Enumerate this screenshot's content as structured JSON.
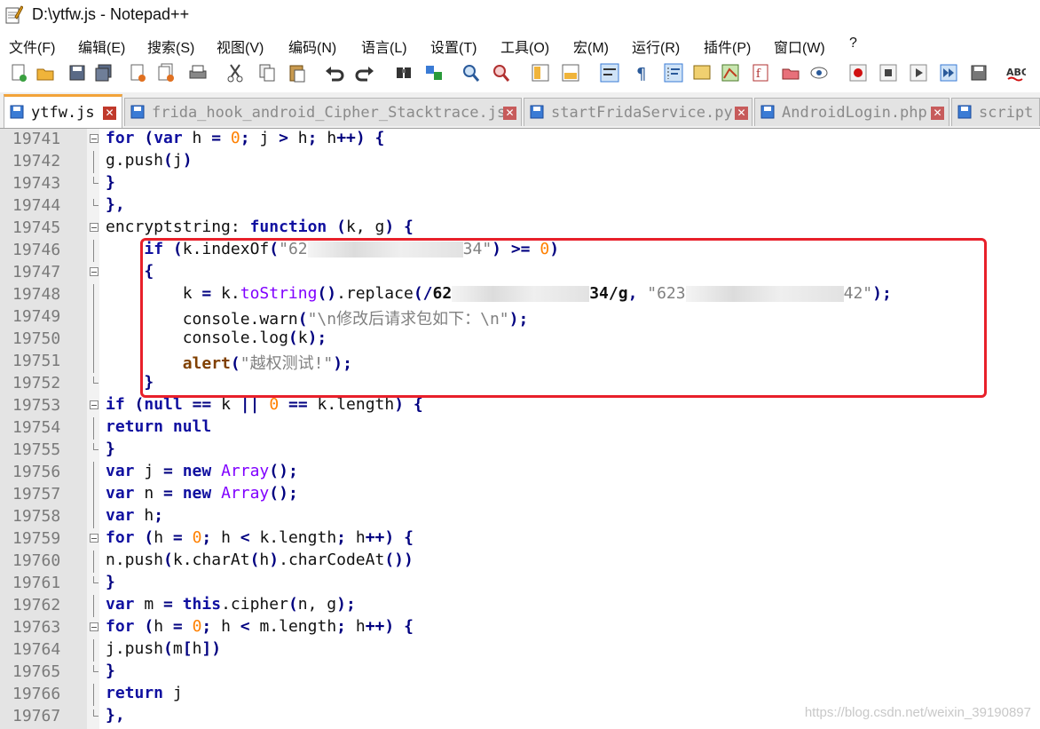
{
  "window": {
    "title": "D:\\ytfw.js - Notepad++"
  },
  "menu": [
    "文件(F)",
    "编辑(E)",
    "搜索(S)",
    "视图(V)",
    "编码(N)",
    "语言(L)",
    "设置(T)",
    "工具(O)",
    "宏(M)",
    "运行(R)",
    "插件(P)",
    "窗口(W)",
    "?"
  ],
  "tabs": [
    {
      "label": "ytfw.js",
      "active": true
    },
    {
      "label": "frida_hook_android_Cipher_Stacktrace.js",
      "active": false
    },
    {
      "label": "startFridaService.py",
      "active": false
    },
    {
      "label": "AndroidLogin.php",
      "active": false
    },
    {
      "label": "script",
      "active": false
    }
  ],
  "lines": [
    {
      "n": "19741",
      "fold": "box",
      "html": "<span class=\"kw\">for</span> <span class=\"op\">(</span><span class=\"kw\">var</span> h <span class=\"op\">=</span> <span class=\"num\">0</span><span class=\"op\">;</span> j <span class=\"op\">&gt;</span> h<span class=\"op\">;</span> h<span class=\"op\">++)</span> <span class=\"op\">{</span>"
    },
    {
      "n": "19742",
      "fold": "bar",
      "html": "g.push<span class=\"op\">(</span>j<span class=\"op\">)</span>"
    },
    {
      "n": "19743",
      "fold": "end",
      "html": "<span class=\"op\">}</span>"
    },
    {
      "n": "19744",
      "fold": "end",
      "html": "<span class=\"op\">},</span>"
    },
    {
      "n": "19745",
      "fold": "box",
      "html": "encryptstring: <span class=\"kw\">function</span> <span class=\"op\">(</span>k, g<span class=\"op\">)</span> <span class=\"op\">{</span>"
    },
    {
      "n": "19746",
      "fold": "bar",
      "html": "    <span class=\"kw\">if</span> <span class=\"op\">(</span>k.indexOf<span class=\"op\">(</span><span class=\"str\">\"62<span class=\"blur\" style=\"width:175px\"></span>34\"</span><span class=\"op\">)</span> <span class=\"op\">&gt;=</span> <span class=\"num\">0</span><span class=\"op\">)</span>"
    },
    {
      "n": "19747",
      "fold": "box",
      "html": "    <span class=\"op\">{</span>"
    },
    {
      "n": "19748",
      "fold": "bar",
      "html": "        k <span class=\"op\">=</span> k.<span class=\"fn\">toString</span><span class=\"op\">()</span>.replace<span class=\"op\">(/</span><b>62<span class=\"blur\" style=\"width:155px\"></span>34/g</b><span class=\"op\">,</span> <span class=\"str\">\"623<span class=\"blur\" style=\"width:178px\"></span>42\"</span><span class=\"op\">);</span>"
    },
    {
      "n": "19749",
      "fold": "bar",
      "html": "        console.warn<span class=\"op\">(</span><span class=\"str\">\"\\n修改后请求包如下：\\n\"</span><span class=\"op\">);</span>"
    },
    {
      "n": "19750",
      "fold": "bar",
      "html": "        console.log<span class=\"op\">(</span>k<span class=\"op\">);</span>"
    },
    {
      "n": "19751",
      "fold": "bar",
      "html": "        <span class=\"fnb\">alert</span><span class=\"op\">(</span><span class=\"str\">\"越权测试!\"</span><span class=\"op\">);</span>"
    },
    {
      "n": "19752",
      "fold": "end",
      "html": "    <span class=\"op\">}</span>"
    },
    {
      "n": "19753",
      "fold": "box",
      "html": "<span class=\"kw\">if</span> <span class=\"op\">(</span><span class=\"kw\">null</span> <span class=\"op\">==</span> k <span class=\"op\">||</span> <span class=\"num\">0</span> <span class=\"op\">==</span> k.length<span class=\"op\">)</span> <span class=\"op\">{</span>"
    },
    {
      "n": "19754",
      "fold": "bar",
      "html": "<span class=\"kw\">return</span> <span class=\"kw\">null</span>"
    },
    {
      "n": "19755",
      "fold": "end",
      "html": "<span class=\"op\">}</span>"
    },
    {
      "n": "19756",
      "fold": "bar",
      "html": "<span class=\"kw\">var</span> j <span class=\"op\">=</span> <span class=\"kw\">new</span> <span class=\"fn\">Array</span><span class=\"op\">();</span>"
    },
    {
      "n": "19757",
      "fold": "bar",
      "html": "<span class=\"kw\">var</span> n <span class=\"op\">=</span> <span class=\"kw\">new</span> <span class=\"fn\">Array</span><span class=\"op\">();</span>"
    },
    {
      "n": "19758",
      "fold": "bar",
      "html": "<span class=\"kw\">var</span> h<span class=\"op\">;</span>"
    },
    {
      "n": "19759",
      "fold": "box",
      "html": "<span class=\"kw\">for</span> <span class=\"op\">(</span>h <span class=\"op\">=</span> <span class=\"num\">0</span><span class=\"op\">;</span> h <span class=\"op\">&lt;</span> k.length<span class=\"op\">;</span> h<span class=\"op\">++)</span> <span class=\"op\">{</span>"
    },
    {
      "n": "19760",
      "fold": "bar",
      "html": "n.push<span class=\"op\">(</span>k.charAt<span class=\"op\">(</span>h<span class=\"op\">)</span>.charCodeAt<span class=\"op\">())</span>"
    },
    {
      "n": "19761",
      "fold": "end",
      "html": "<span class=\"op\">}</span>"
    },
    {
      "n": "19762",
      "fold": "bar",
      "html": "<span class=\"kw\">var</span> m <span class=\"op\">=</span> <span class=\"kw\">this</span>.cipher<span class=\"op\">(</span>n, g<span class=\"op\">);</span>"
    },
    {
      "n": "19763",
      "fold": "box",
      "html": "<span class=\"kw\">for</span> <span class=\"op\">(</span>h <span class=\"op\">=</span> <span class=\"num\">0</span><span class=\"op\">;</span> h <span class=\"op\">&lt;</span> m.length<span class=\"op\">;</span> h<span class=\"op\">++)</span> <span class=\"op\">{</span>"
    },
    {
      "n": "19764",
      "fold": "bar",
      "html": "j.push<span class=\"op\">(</span>m<span class=\"op\">[</span>h<span class=\"op\">])</span>"
    },
    {
      "n": "19765",
      "fold": "end",
      "html": "<span class=\"op\">}</span>"
    },
    {
      "n": "19766",
      "fold": "bar",
      "html": "<span class=\"kw\">return</span> j"
    },
    {
      "n": "19767",
      "fold": "end",
      "html": "<span class=\"op\">},</span>"
    }
  ],
  "watermark": "https://blog.csdn.net/weixin_39190897",
  "colors": {
    "highlight_box": "#e8202a",
    "active_tab_accent": "#f2a33a",
    "gutter": "#e4e4e4"
  }
}
